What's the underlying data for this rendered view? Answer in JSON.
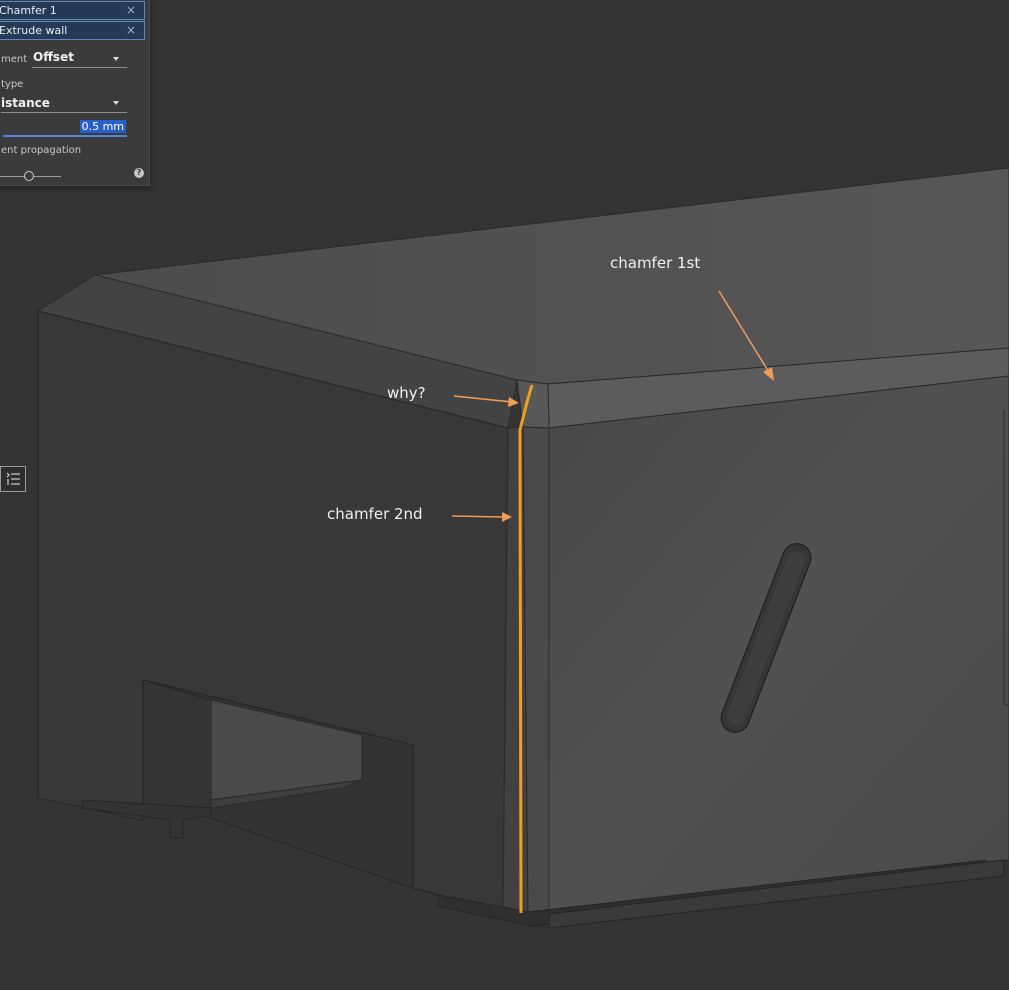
{
  "panel": {
    "selections": [
      {
        "label": "Chamfer 1",
        "remove_glyph": "×"
      },
      {
        "label": "Extrude wall",
        "remove_glyph": "×"
      }
    ],
    "measurement_label": "ment",
    "measurement_value": "Offset",
    "type_label": "type",
    "type_value": "istance",
    "distance_value": "0.5 mm",
    "propagation_label": "ent propagation",
    "help_glyph": "?"
  },
  "viewport": {
    "annotations": {
      "chamfer_first": "chamfer 1st",
      "why": "why?",
      "chamfer_second": "chamfer 2nd"
    },
    "highlight_color": "#f0a020",
    "arrow_color": "#f29c55"
  },
  "icons": [
    "list-view-icon",
    "chevron-down-icon",
    "close-icon",
    "help-icon"
  ]
}
